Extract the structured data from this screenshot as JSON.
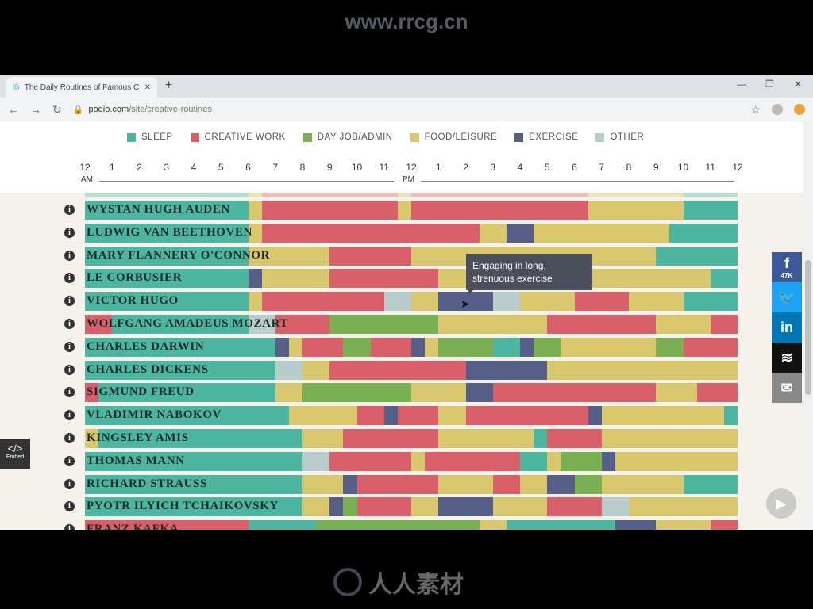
{
  "watermark": {
    "top": "www.rrcg.cn",
    "bottom": "人人素材"
  },
  "browser": {
    "tab_title": "The Daily Routines of Famous Cr",
    "url_domain": "podio.com",
    "url_path": "/site/creative-routines"
  },
  "colors": {
    "sleep": "#4db6a1",
    "creative": "#d9606a",
    "dayjob": "#7aaf52",
    "food": "#d8c76c",
    "exercise": "#555f88",
    "other": "#b8cccb"
  },
  "legend": [
    {
      "key": "sleep",
      "label": "SLEEP"
    },
    {
      "key": "creative",
      "label": "CREATIVE WORK"
    },
    {
      "key": "dayjob",
      "label": "DAY JOB/ADMIN"
    },
    {
      "key": "food",
      "label": "FOOD/LEISURE"
    },
    {
      "key": "exercise",
      "label": "EXERCISE"
    },
    {
      "key": "other",
      "label": "OTHER"
    }
  ],
  "timeline": {
    "ticks": [
      "12",
      "1",
      "2",
      "3",
      "4",
      "5",
      "6",
      "7",
      "8",
      "9",
      "10",
      "11",
      "12",
      "1",
      "2",
      "3",
      "4",
      "5",
      "6",
      "7",
      "8",
      "9",
      "10",
      "11",
      "12"
    ],
    "am": "AM",
    "pm": "PM"
  },
  "rows": [
    {
      "name": "WYSTAN HUGH AUDEN",
      "segments": [
        [
          0,
          6,
          "sleep"
        ],
        [
          6,
          6.5,
          "food"
        ],
        [
          6.5,
          11.5,
          "creative"
        ],
        [
          11.5,
          12,
          "food"
        ],
        [
          12,
          18.5,
          "creative"
        ],
        [
          18.5,
          22,
          "food"
        ],
        [
          22,
          24,
          "sleep"
        ]
      ]
    },
    {
      "name": "LUDWIG VAN BEETHOVEN",
      "segments": [
        [
          0,
          6,
          "sleep"
        ],
        [
          6,
          6.5,
          "food"
        ],
        [
          6.5,
          14.5,
          "creative"
        ],
        [
          14.5,
          15.5,
          "food"
        ],
        [
          15.5,
          16.5,
          "exercise"
        ],
        [
          16.5,
          21.5,
          "food"
        ],
        [
          21.5,
          24,
          "sleep"
        ]
      ]
    },
    {
      "name": "MARY FLANNERY O'CONNOR",
      "segments": [
        [
          0,
          6,
          "sleep"
        ],
        [
          6,
          9,
          "food"
        ],
        [
          9,
          12,
          "creative"
        ],
        [
          12,
          21,
          "food"
        ],
        [
          21,
          24,
          "sleep"
        ]
      ]
    },
    {
      "name": "LE CORBUSIER",
      "segments": [
        [
          0,
          6,
          "sleep"
        ],
        [
          6,
          6.5,
          "exercise"
        ],
        [
          6.5,
          9,
          "food"
        ],
        [
          9,
          13,
          "creative"
        ],
        [
          13,
          23,
          "food"
        ],
        [
          23,
          24,
          "sleep"
        ]
      ]
    },
    {
      "name": "VICTOR HUGO",
      "segments": [
        [
          0,
          6,
          "sleep"
        ],
        [
          6,
          6.5,
          "food"
        ],
        [
          6.5,
          11,
          "creative"
        ],
        [
          11,
          12,
          "other"
        ],
        [
          12,
          13,
          "food"
        ],
        [
          13,
          15,
          "exercise"
        ],
        [
          15,
          16,
          "other"
        ],
        [
          16,
          18,
          "food"
        ],
        [
          18,
          20,
          "creative"
        ],
        [
          20,
          22,
          "food"
        ],
        [
          22,
          24,
          "sleep"
        ]
      ]
    },
    {
      "name": "WOLFGANG AMADEUS MOZART",
      "segments": [
        [
          0,
          1,
          "creative"
        ],
        [
          1,
          6,
          "sleep"
        ],
        [
          6,
          7,
          "other"
        ],
        [
          7,
          9,
          "creative"
        ],
        [
          9,
          13,
          "dayjob"
        ],
        [
          13,
          17,
          "food"
        ],
        [
          17,
          21,
          "creative"
        ],
        [
          21,
          23,
          "food"
        ],
        [
          23,
          24,
          "creative"
        ]
      ]
    },
    {
      "name": "CHARLES DARWIN",
      "segments": [
        [
          0,
          7,
          "sleep"
        ],
        [
          7,
          7.5,
          "exercise"
        ],
        [
          7.5,
          8,
          "food"
        ],
        [
          8,
          9.5,
          "creative"
        ],
        [
          9.5,
          10.5,
          "dayjob"
        ],
        [
          10.5,
          12,
          "creative"
        ],
        [
          12,
          12.5,
          "exercise"
        ],
        [
          12.5,
          13,
          "food"
        ],
        [
          13,
          15,
          "dayjob"
        ],
        [
          15,
          16,
          "sleep"
        ],
        [
          16,
          16.5,
          "exercise"
        ],
        [
          16.5,
          17.5,
          "dayjob"
        ],
        [
          17.5,
          21,
          "food"
        ],
        [
          21,
          22,
          "dayjob"
        ],
        [
          22,
          24,
          "creative"
        ]
      ]
    },
    {
      "name": "CHARLES DICKENS",
      "segments": [
        [
          0,
          7,
          "sleep"
        ],
        [
          7,
          8,
          "other"
        ],
        [
          8,
          9,
          "food"
        ],
        [
          9,
          14,
          "creative"
        ],
        [
          14,
          17,
          "exercise"
        ],
        [
          17,
          24,
          "food"
        ]
      ]
    },
    {
      "name": "SIGMUND FREUD",
      "segments": [
        [
          0,
          0.5,
          "creative"
        ],
        [
          0.5,
          7,
          "sleep"
        ],
        [
          7,
          8,
          "food"
        ],
        [
          8,
          12,
          "dayjob"
        ],
        [
          12,
          14,
          "food"
        ],
        [
          14,
          15,
          "exercise"
        ],
        [
          15,
          21,
          "creative"
        ],
        [
          21,
          22.5,
          "food"
        ],
        [
          22.5,
          24,
          "creative"
        ]
      ]
    },
    {
      "name": "VLADIMIR NABOKOV",
      "segments": [
        [
          0,
          7.5,
          "sleep"
        ],
        [
          7.5,
          10,
          "food"
        ],
        [
          10,
          11,
          "creative"
        ],
        [
          11,
          11.5,
          "exercise"
        ],
        [
          11.5,
          13,
          "creative"
        ],
        [
          13,
          14,
          "food"
        ],
        [
          14,
          18.5,
          "creative"
        ],
        [
          18.5,
          19,
          "exercise"
        ],
        [
          19,
          23.5,
          "food"
        ],
        [
          23.5,
          24,
          "sleep"
        ]
      ]
    },
    {
      "name": "KINGSLEY AMIS",
      "segments": [
        [
          0,
          0.5,
          "food"
        ],
        [
          0.5,
          8,
          "sleep"
        ],
        [
          8,
          9.5,
          "food"
        ],
        [
          9.5,
          13,
          "creative"
        ],
        [
          13,
          16.5,
          "food"
        ],
        [
          16.5,
          17,
          "sleep"
        ],
        [
          17,
          19,
          "creative"
        ],
        [
          19,
          24,
          "food"
        ]
      ]
    },
    {
      "name": "THOMAS MANN",
      "segments": [
        [
          0,
          8,
          "sleep"
        ],
        [
          8,
          9,
          "other"
        ],
        [
          9,
          12,
          "creative"
        ],
        [
          12,
          12.5,
          "food"
        ],
        [
          12.5,
          16,
          "creative"
        ],
        [
          16,
          17,
          "sleep"
        ],
        [
          17,
          17.5,
          "food"
        ],
        [
          17.5,
          19,
          "dayjob"
        ],
        [
          19,
          19.5,
          "exercise"
        ],
        [
          19.5,
          24,
          "food"
        ]
      ]
    },
    {
      "name": "RICHARD STRAUSS",
      "segments": [
        [
          0,
          8,
          "sleep"
        ],
        [
          8,
          9.5,
          "food"
        ],
        [
          9.5,
          10,
          "exercise"
        ],
        [
          10,
          13,
          "creative"
        ],
        [
          13,
          15,
          "food"
        ],
        [
          15,
          16,
          "creative"
        ],
        [
          16,
          17,
          "food"
        ],
        [
          17,
          18,
          "exercise"
        ],
        [
          18,
          19,
          "dayjob"
        ],
        [
          19,
          22,
          "food"
        ],
        [
          22,
          24,
          "sleep"
        ]
      ]
    },
    {
      "name": "PYOTR ILYICH TCHAIKOVSKY",
      "segments": [
        [
          0,
          8,
          "sleep"
        ],
        [
          8,
          9,
          "food"
        ],
        [
          9,
          9.5,
          "exercise"
        ],
        [
          9.5,
          10,
          "dayjob"
        ],
        [
          10,
          12,
          "creative"
        ],
        [
          12,
          13,
          "food"
        ],
        [
          13,
          15,
          "exercise"
        ],
        [
          15,
          17,
          "food"
        ],
        [
          17,
          19,
          "creative"
        ],
        [
          19,
          20,
          "other"
        ],
        [
          20,
          24,
          "food"
        ]
      ]
    },
    {
      "name": "FRANZ KAFKA",
      "segments": [
        [
          0,
          6,
          "creative"
        ],
        [
          6,
          8.5,
          "sleep"
        ],
        [
          8.5,
          14.5,
          "dayjob"
        ],
        [
          14.5,
          15.5,
          "food"
        ],
        [
          15.5,
          19.5,
          "sleep"
        ],
        [
          19.5,
          21,
          "exercise"
        ],
        [
          21,
          23,
          "food"
        ],
        [
          23,
          24,
          "creative"
        ]
      ]
    }
  ],
  "tooltip": {
    "text": "Engaging in long, strenuous exercise"
  },
  "social": [
    {
      "icon": "facebook-icon",
      "glyph": "f",
      "count": "47K",
      "color": "#3b5998"
    },
    {
      "icon": "twitter-icon",
      "glyph": "🐦",
      "color": "#1da1f2"
    },
    {
      "icon": "linkedin-icon",
      "glyph": "in",
      "color": "#0077b5"
    },
    {
      "icon": "buffer-icon",
      "glyph": "≋",
      "color": "#111"
    },
    {
      "icon": "email-icon",
      "glyph": "✉",
      "color": "#888"
    }
  ],
  "embed": {
    "glyph": "</>",
    "label": "Embed"
  }
}
